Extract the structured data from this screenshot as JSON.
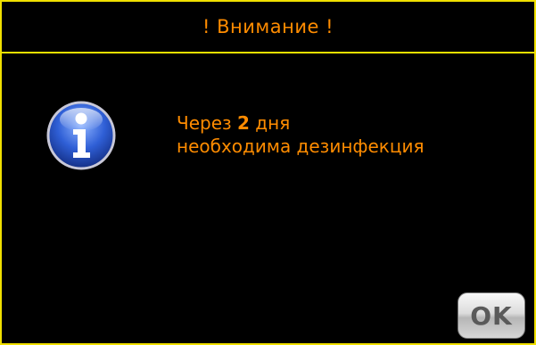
{
  "dialog": {
    "title": "! Внимание !",
    "icon": "info-icon",
    "message": {
      "prefix": "Через ",
      "days": "2",
      "suffix": " дня",
      "line2": "необходима дезинфекция"
    },
    "ok_label": "OK"
  },
  "colors": {
    "background": "#000000",
    "border": "#f0e000",
    "text": "#ff8c00"
  }
}
